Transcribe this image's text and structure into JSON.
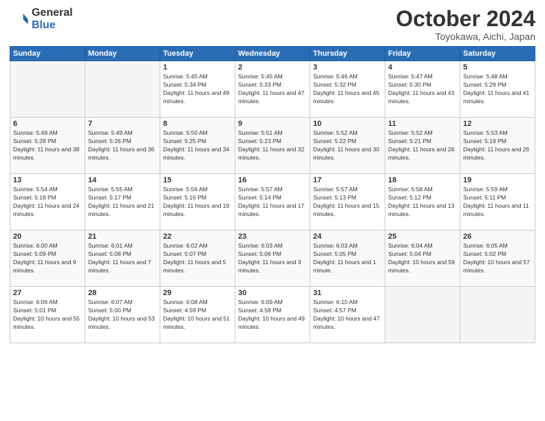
{
  "header": {
    "logo_general": "General",
    "logo_blue": "Blue",
    "month_title": "October 2024",
    "location": "Toyokawa, Aichi, Japan"
  },
  "weekdays": [
    "Sunday",
    "Monday",
    "Tuesday",
    "Wednesday",
    "Thursday",
    "Friday",
    "Saturday"
  ],
  "weeks": [
    [
      {
        "day": "",
        "info": ""
      },
      {
        "day": "",
        "info": ""
      },
      {
        "day": "1",
        "info": "Sunrise: 5:45 AM\nSunset: 5:34 PM\nDaylight: 11 hours and 49 minutes."
      },
      {
        "day": "2",
        "info": "Sunrise: 5:45 AM\nSunset: 5:33 PM\nDaylight: 11 hours and 47 minutes."
      },
      {
        "day": "3",
        "info": "Sunrise: 5:46 AM\nSunset: 5:32 PM\nDaylight: 11 hours and 45 minutes."
      },
      {
        "day": "4",
        "info": "Sunrise: 5:47 AM\nSunset: 5:30 PM\nDaylight: 11 hours and 43 minutes."
      },
      {
        "day": "5",
        "info": "Sunrise: 5:48 AM\nSunset: 5:29 PM\nDaylight: 11 hours and 41 minutes."
      }
    ],
    [
      {
        "day": "6",
        "info": "Sunrise: 5:49 AM\nSunset: 5:28 PM\nDaylight: 11 hours and 38 minutes."
      },
      {
        "day": "7",
        "info": "Sunrise: 5:49 AM\nSunset: 5:26 PM\nDaylight: 11 hours and 36 minutes."
      },
      {
        "day": "8",
        "info": "Sunrise: 5:50 AM\nSunset: 5:25 PM\nDaylight: 11 hours and 34 minutes."
      },
      {
        "day": "9",
        "info": "Sunrise: 5:51 AM\nSunset: 5:23 PM\nDaylight: 11 hours and 32 minutes."
      },
      {
        "day": "10",
        "info": "Sunrise: 5:52 AM\nSunset: 5:22 PM\nDaylight: 11 hours and 30 minutes."
      },
      {
        "day": "11",
        "info": "Sunrise: 5:52 AM\nSunset: 5:21 PM\nDaylight: 11 hours and 28 minutes."
      },
      {
        "day": "12",
        "info": "Sunrise: 5:53 AM\nSunset: 5:19 PM\nDaylight: 11 hours and 26 minutes."
      }
    ],
    [
      {
        "day": "13",
        "info": "Sunrise: 5:54 AM\nSunset: 5:18 PM\nDaylight: 11 hours and 24 minutes."
      },
      {
        "day": "14",
        "info": "Sunrise: 5:55 AM\nSunset: 5:17 PM\nDaylight: 11 hours and 21 minutes."
      },
      {
        "day": "15",
        "info": "Sunrise: 5:56 AM\nSunset: 5:16 PM\nDaylight: 11 hours and 19 minutes."
      },
      {
        "day": "16",
        "info": "Sunrise: 5:57 AM\nSunset: 5:14 PM\nDaylight: 11 hours and 17 minutes."
      },
      {
        "day": "17",
        "info": "Sunrise: 5:57 AM\nSunset: 5:13 PM\nDaylight: 11 hours and 15 minutes."
      },
      {
        "day": "18",
        "info": "Sunrise: 5:58 AM\nSunset: 5:12 PM\nDaylight: 11 hours and 13 minutes."
      },
      {
        "day": "19",
        "info": "Sunrise: 5:59 AM\nSunset: 5:11 PM\nDaylight: 11 hours and 11 minutes."
      }
    ],
    [
      {
        "day": "20",
        "info": "Sunrise: 6:00 AM\nSunset: 5:09 PM\nDaylight: 11 hours and 9 minutes."
      },
      {
        "day": "21",
        "info": "Sunrise: 6:01 AM\nSunset: 5:08 PM\nDaylight: 11 hours and 7 minutes."
      },
      {
        "day": "22",
        "info": "Sunrise: 6:02 AM\nSunset: 5:07 PM\nDaylight: 11 hours and 5 minutes."
      },
      {
        "day": "23",
        "info": "Sunrise: 6:03 AM\nSunset: 5:06 PM\nDaylight: 11 hours and 3 minutes."
      },
      {
        "day": "24",
        "info": "Sunrise: 6:03 AM\nSunset: 5:05 PM\nDaylight: 11 hours and 1 minute."
      },
      {
        "day": "25",
        "info": "Sunrise: 6:04 AM\nSunset: 5:04 PM\nDaylight: 10 hours and 59 minutes."
      },
      {
        "day": "26",
        "info": "Sunrise: 6:05 AM\nSunset: 5:02 PM\nDaylight: 10 hours and 57 minutes."
      }
    ],
    [
      {
        "day": "27",
        "info": "Sunrise: 6:06 AM\nSunset: 5:01 PM\nDaylight: 10 hours and 55 minutes."
      },
      {
        "day": "28",
        "info": "Sunrise: 6:07 AM\nSunset: 5:00 PM\nDaylight: 10 hours and 53 minutes."
      },
      {
        "day": "29",
        "info": "Sunrise: 6:08 AM\nSunset: 4:59 PM\nDaylight: 10 hours and 51 minutes."
      },
      {
        "day": "30",
        "info": "Sunrise: 6:09 AM\nSunset: 4:58 PM\nDaylight: 10 hours and 49 minutes."
      },
      {
        "day": "31",
        "info": "Sunrise: 6:10 AM\nSunset: 4:57 PM\nDaylight: 10 hours and 47 minutes."
      },
      {
        "day": "",
        "info": ""
      },
      {
        "day": "",
        "info": ""
      }
    ]
  ]
}
